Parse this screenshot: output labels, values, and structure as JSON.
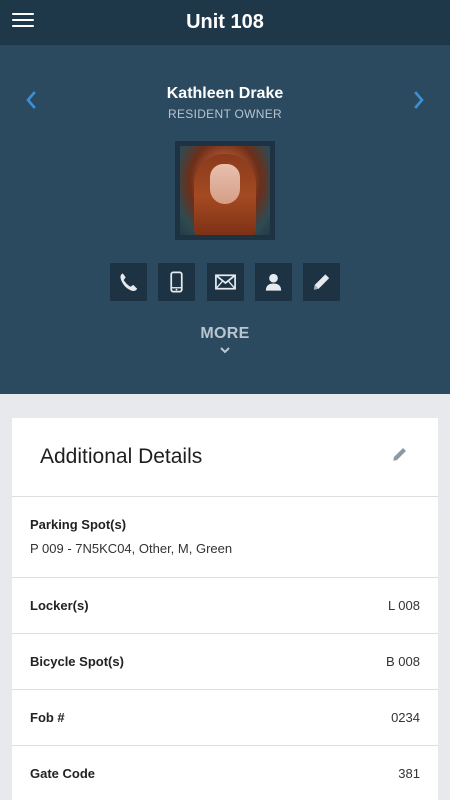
{
  "app": {
    "title": "Unit 108"
  },
  "colors": {
    "header": "#1f3849",
    "hero": "#2b4a60",
    "accent": "#3d8fd6",
    "button": "#1d3344"
  },
  "resident": {
    "name": "Kathleen Drake",
    "role": "RESIDENT OWNER"
  },
  "actions": [
    {
      "icon": "phone-icon"
    },
    {
      "icon": "mobile-icon"
    },
    {
      "icon": "mail-icon"
    },
    {
      "icon": "person-icon"
    },
    {
      "icon": "pencil-icon"
    }
  ],
  "more": {
    "label": "MORE"
  },
  "details": {
    "title": "Additional Details",
    "parking": {
      "label": "Parking Spot(s)",
      "value": "P 009 - 7N5KC04, Other, M, Green"
    },
    "locker": {
      "label": "Locker(s)",
      "value": "L 008"
    },
    "bicycle": {
      "label": "Bicycle Spot(s)",
      "value": "B 008"
    },
    "fob": {
      "label": "Fob #",
      "value": "0234"
    },
    "gate": {
      "label": "Gate Code",
      "value": "381"
    }
  }
}
